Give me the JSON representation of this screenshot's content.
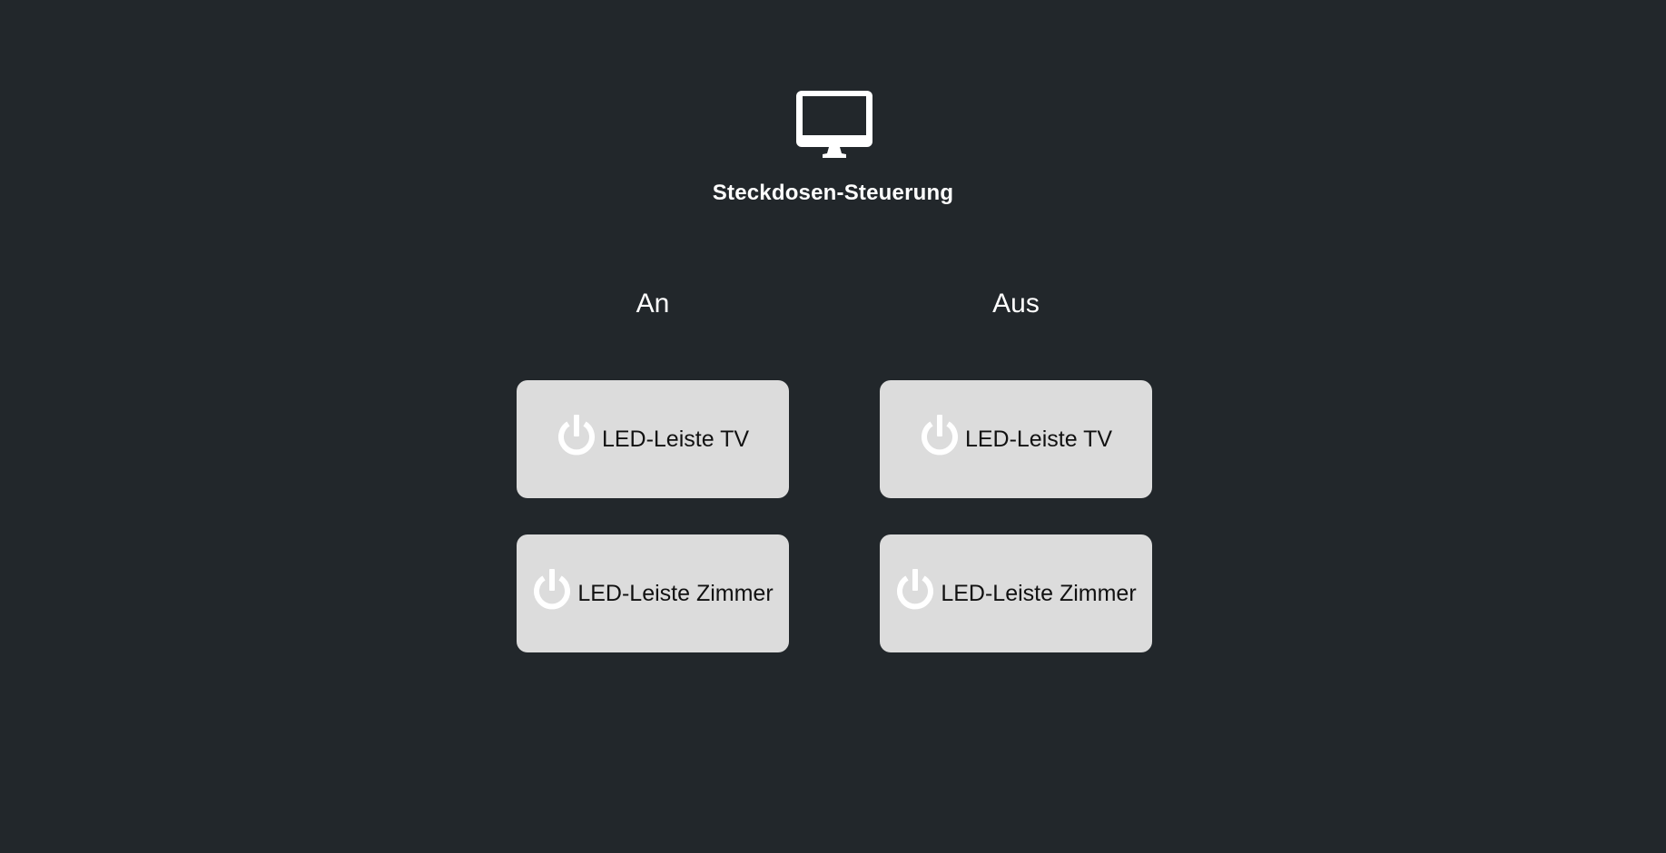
{
  "app": {
    "title": "Steckdosen-Steuerung",
    "icon": "monitor-icon"
  },
  "columns": {
    "on_heading": "An",
    "off_heading": "Aus"
  },
  "buttons": {
    "on": [
      {
        "label": "LED-Leiste TV",
        "icon": "power-icon"
      },
      {
        "label": "LED-Leiste Zimmer",
        "icon": "power-icon"
      }
    ],
    "off": [
      {
        "label": "LED-Leiste TV",
        "icon": "power-icon"
      },
      {
        "label": "LED-Leiste Zimmer",
        "icon": "power-icon"
      }
    ]
  },
  "colors": {
    "background": "#22272b",
    "button": "#dcdcdc",
    "icon": "#ffffff",
    "text_light": "#ffffff",
    "text_dark": "#111111"
  }
}
